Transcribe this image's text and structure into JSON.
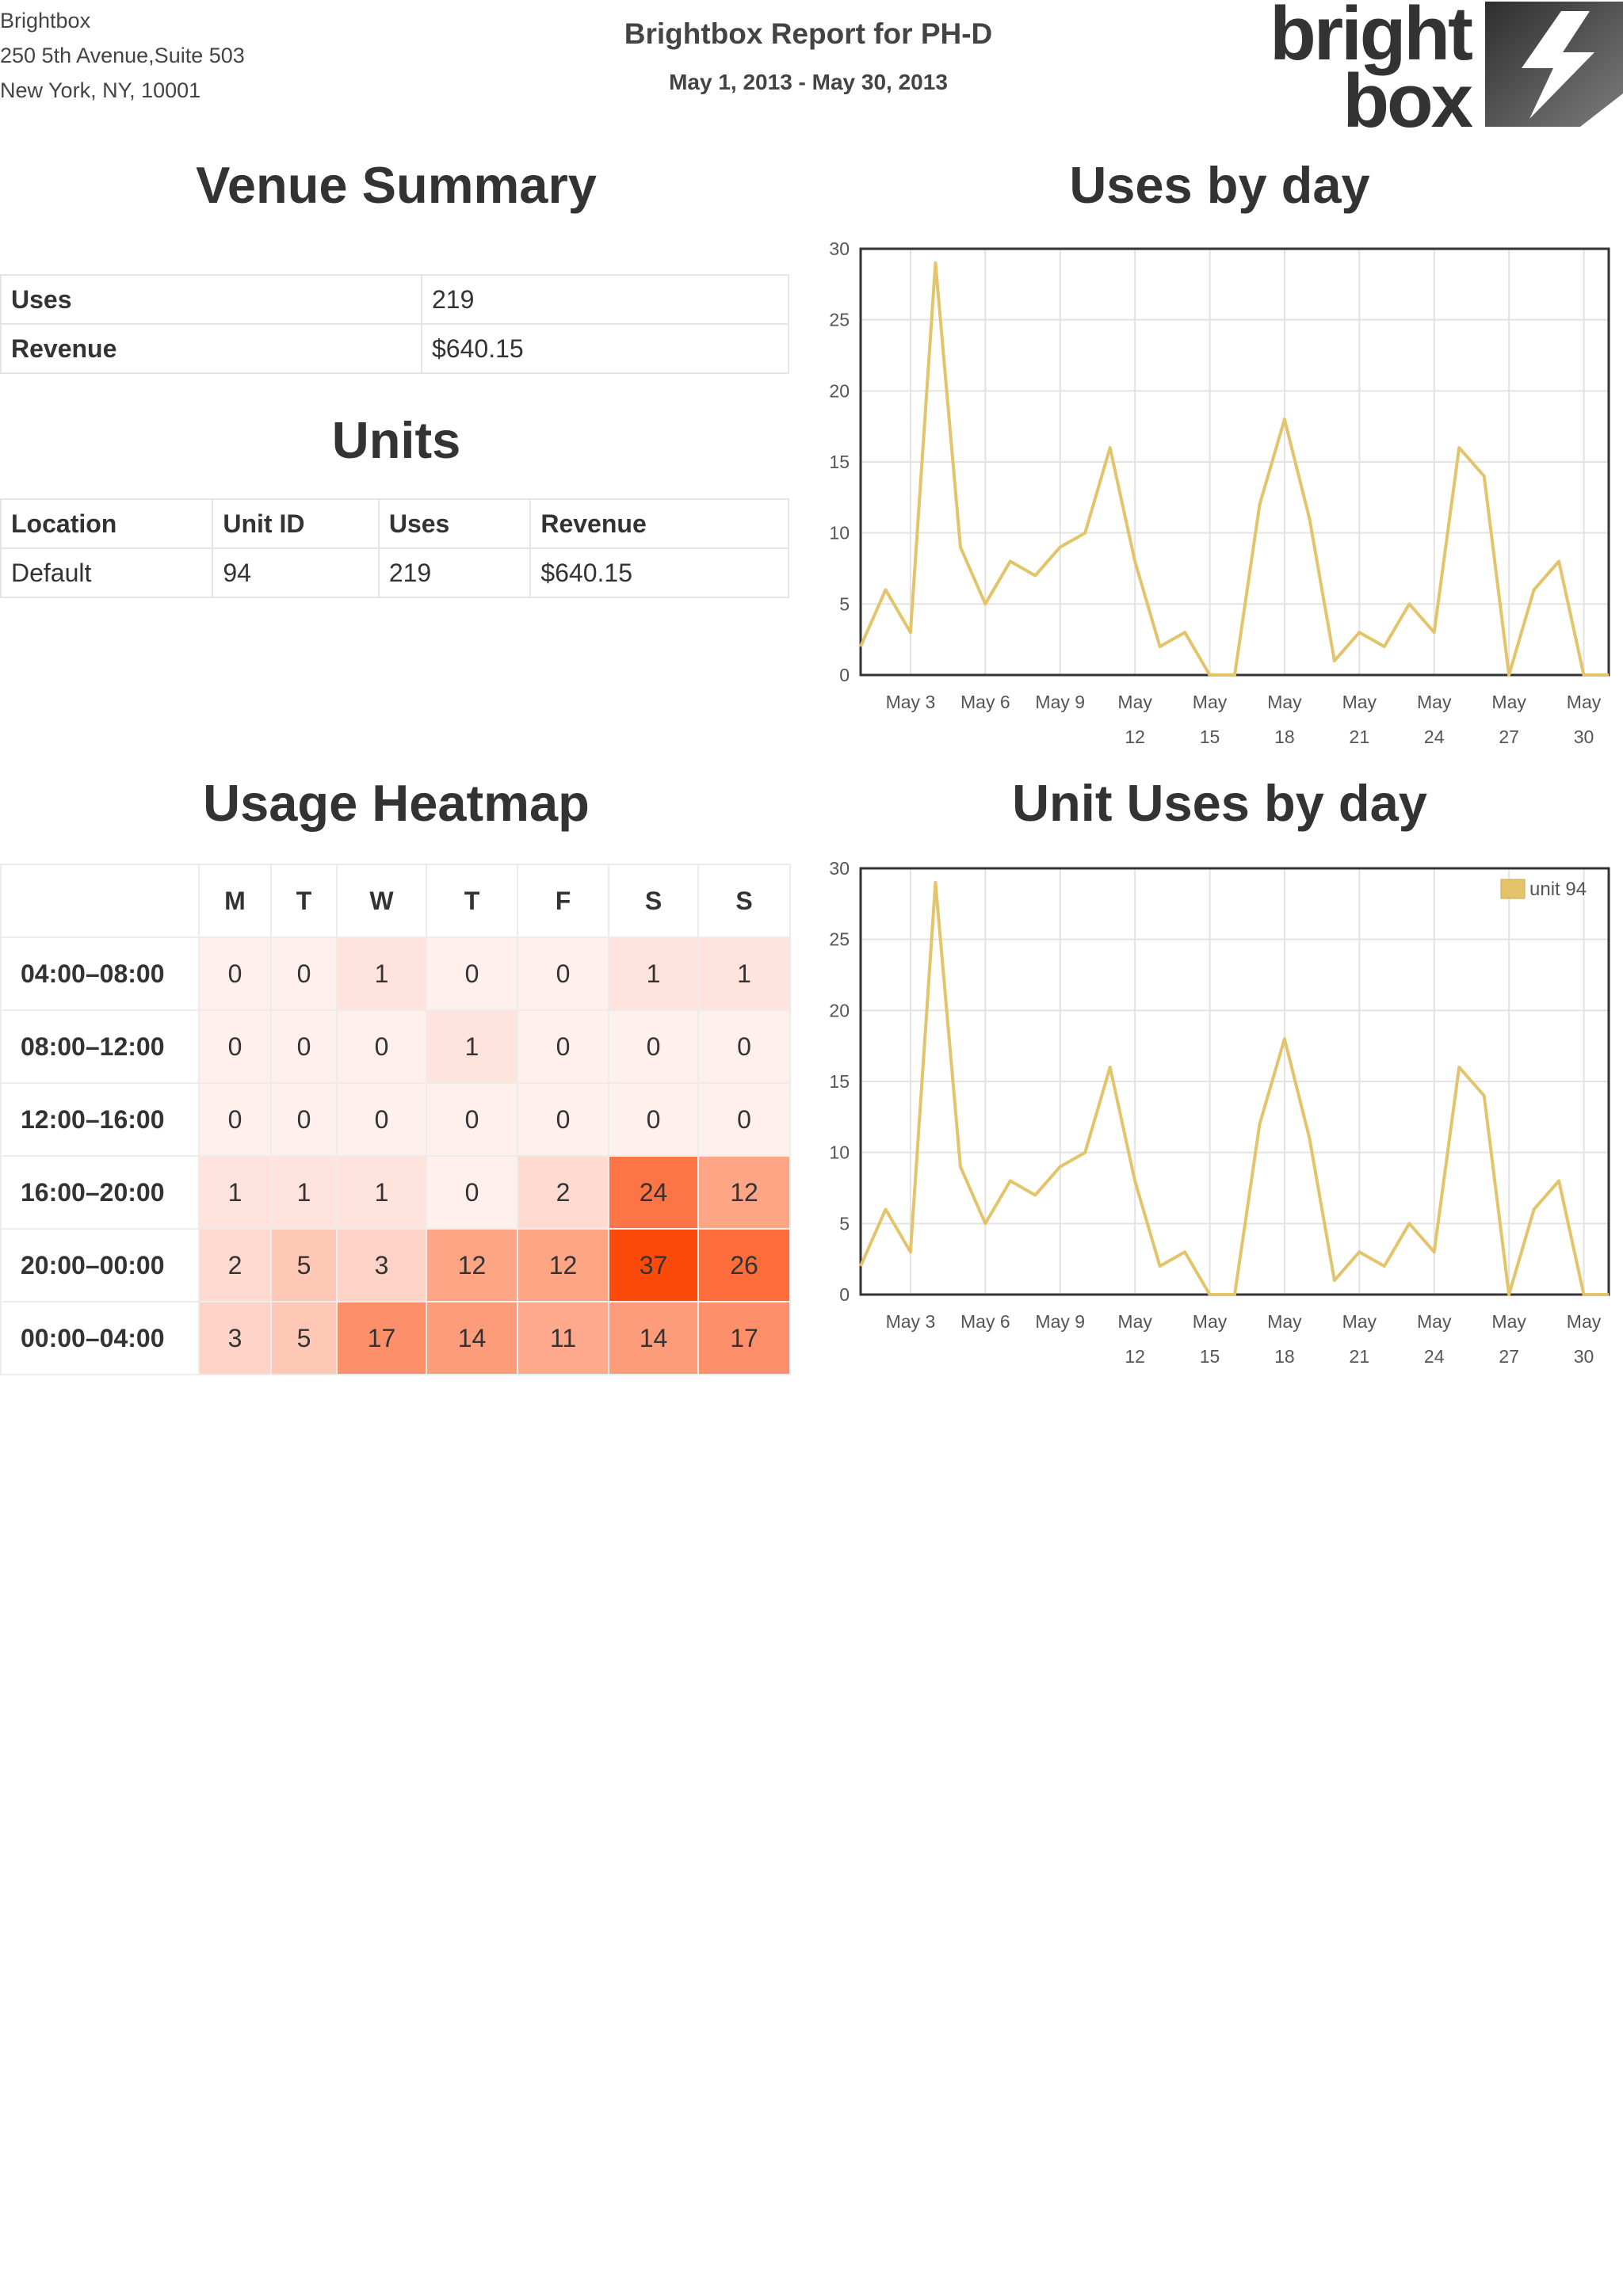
{
  "header": {
    "company": "Brightbox",
    "address_line1": "250 5th Avenue,Suite 503",
    "address_line2": "New York, NY, 10001",
    "report_title": "Brightbox Report for PH-D",
    "date_range": "May 1, 2013 - May 30, 2013",
    "logo_line1": "bright",
    "logo_line2": "box"
  },
  "venue_summary": {
    "title": "Venue Summary",
    "rows": [
      {
        "label": "Uses",
        "value": "219"
      },
      {
        "label": "Revenue",
        "value": "$640.15"
      }
    ]
  },
  "units": {
    "title": "Units",
    "headers": [
      "Location",
      "Unit ID",
      "Uses",
      "Revenue"
    ],
    "rows": [
      [
        "Default",
        "94",
        "219",
        "$640.15"
      ]
    ]
  },
  "heatmap": {
    "title": "Usage Heatmap",
    "days": [
      "M",
      "T",
      "W",
      "T",
      "F",
      "S",
      "S"
    ],
    "rows": [
      {
        "label": "04:00–08:00",
        "values": [
          0,
          0,
          1,
          0,
          0,
          1,
          1
        ]
      },
      {
        "label": "08:00–12:00",
        "values": [
          0,
          0,
          0,
          1,
          0,
          0,
          0
        ]
      },
      {
        "label": "12:00–16:00",
        "values": [
          0,
          0,
          0,
          0,
          0,
          0,
          0
        ]
      },
      {
        "label": "16:00–20:00",
        "values": [
          1,
          1,
          1,
          0,
          2,
          24,
          12
        ]
      },
      {
        "label": "20:00–00:00",
        "values": [
          2,
          5,
          3,
          12,
          12,
          37,
          26
        ]
      },
      {
        "label": "00:00–04:00",
        "values": [
          3,
          5,
          17,
          14,
          11,
          14,
          17
        ]
      }
    ]
  },
  "chart_data": [
    {
      "type": "line",
      "title": "Uses by day",
      "xlabel": "",
      "ylabel": "",
      "x_ticks": [
        "May 3",
        "May 6",
        "May 9",
        "May 12",
        "May 15",
        "May 18",
        "May 21",
        "May 24",
        "May 27",
        "May 30"
      ],
      "x": [
        "May 1",
        "May 2",
        "May 3",
        "May 4",
        "May 5",
        "May 6",
        "May 7",
        "May 8",
        "May 9",
        "May 10",
        "May 11",
        "May 12",
        "May 13",
        "May 14",
        "May 15",
        "May 16",
        "May 17",
        "May 18",
        "May 19",
        "May 20",
        "May 21",
        "May 22",
        "May 23",
        "May 24",
        "May 25",
        "May 26",
        "May 27",
        "May 28",
        "May 29",
        "May 30",
        "May 31"
      ],
      "ylim": [
        0,
        30
      ],
      "y_ticks": [
        0,
        5,
        10,
        15,
        20,
        25,
        30
      ],
      "grid": true,
      "series": [
        {
          "values": [
            2,
            6,
            3,
            29,
            9,
            5,
            8,
            7,
            9,
            10,
            16,
            8,
            2,
            3,
            0,
            0,
            12,
            18,
            11,
            1,
            3,
            2,
            5,
            3,
            16,
            14,
            0,
            6,
            8,
            0,
            0
          ],
          "color": "#e3c46a"
        }
      ]
    },
    {
      "type": "line",
      "title": "Unit Uses by day",
      "xlabel": "",
      "ylabel": "",
      "x_ticks": [
        "May 3",
        "May 6",
        "May 9",
        "May 12",
        "May 15",
        "May 18",
        "May 21",
        "May 24",
        "May 27",
        "May 30"
      ],
      "x": [
        "May 1",
        "May 2",
        "May 3",
        "May 4",
        "May 5",
        "May 6",
        "May 7",
        "May 8",
        "May 9",
        "May 10",
        "May 11",
        "May 12",
        "May 13",
        "May 14",
        "May 15",
        "May 16",
        "May 17",
        "May 18",
        "May 19",
        "May 20",
        "May 21",
        "May 22",
        "May 23",
        "May 24",
        "May 25",
        "May 26",
        "May 27",
        "May 28",
        "May 29",
        "May 30",
        "May 31"
      ],
      "ylim": [
        0,
        30
      ],
      "y_ticks": [
        0,
        5,
        10,
        15,
        20,
        25,
        30
      ],
      "grid": true,
      "legend": "top-right",
      "series": [
        {
          "name": "unit 94",
          "values": [
            2,
            6,
            3,
            29,
            9,
            5,
            8,
            7,
            9,
            10,
            16,
            8,
            2,
            3,
            0,
            0,
            12,
            18,
            11,
            1,
            3,
            2,
            5,
            3,
            16,
            14,
            0,
            6,
            8,
            0,
            0
          ],
          "color": "#e3c46a"
        }
      ]
    }
  ]
}
